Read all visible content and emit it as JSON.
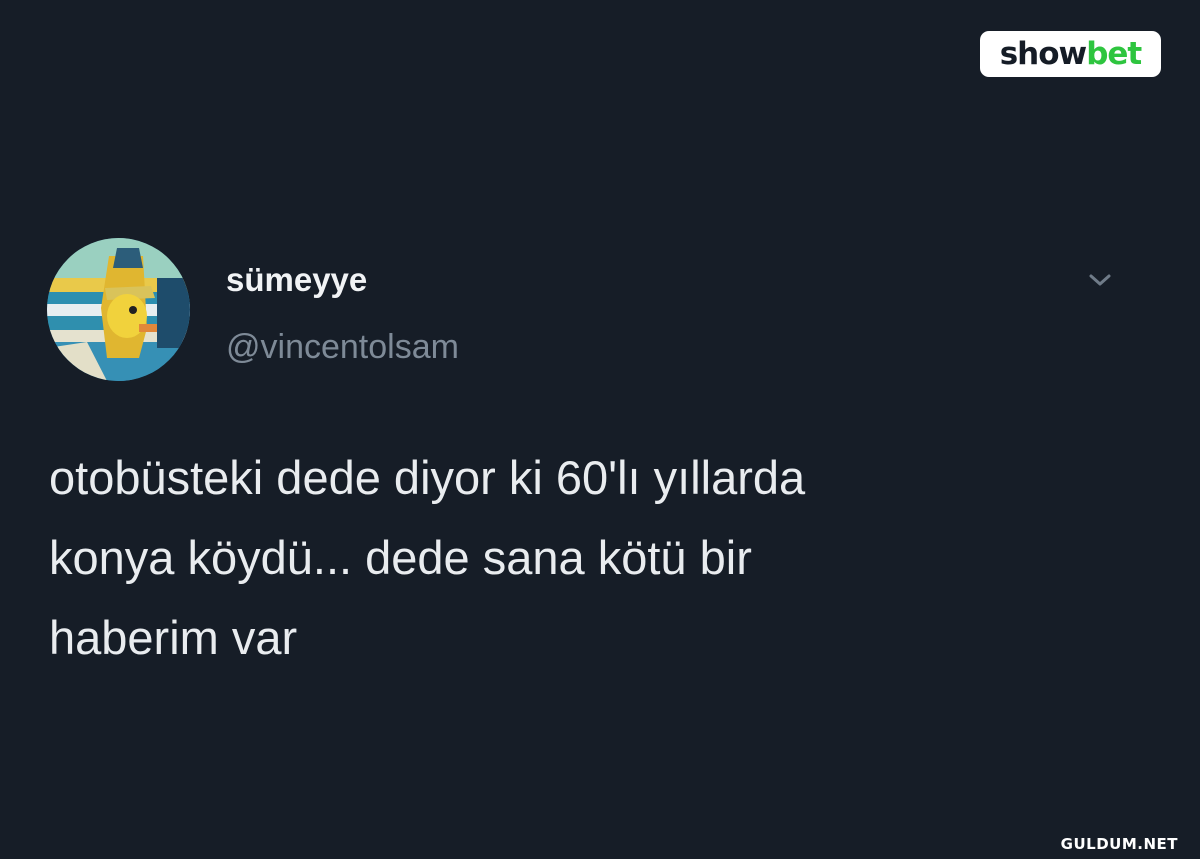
{
  "brand": {
    "part_a": "show",
    "part_b": "bet",
    "accent": "#2ec53f"
  },
  "tweet": {
    "display_name": "sümeyye",
    "handle": "@vincentolsam",
    "text": "otobüsteki dede diyor ki 60'lı yıllarda\nkonya köydü... dede sana kötü bir\nhaberim var",
    "menu_icon": "chevron-down-icon"
  },
  "watermark": "GULDUM.NET",
  "colors": {
    "background": "#161d27",
    "name": "#f1f3f5",
    "handle": "#7e8a97",
    "text": "#e9ecef"
  }
}
